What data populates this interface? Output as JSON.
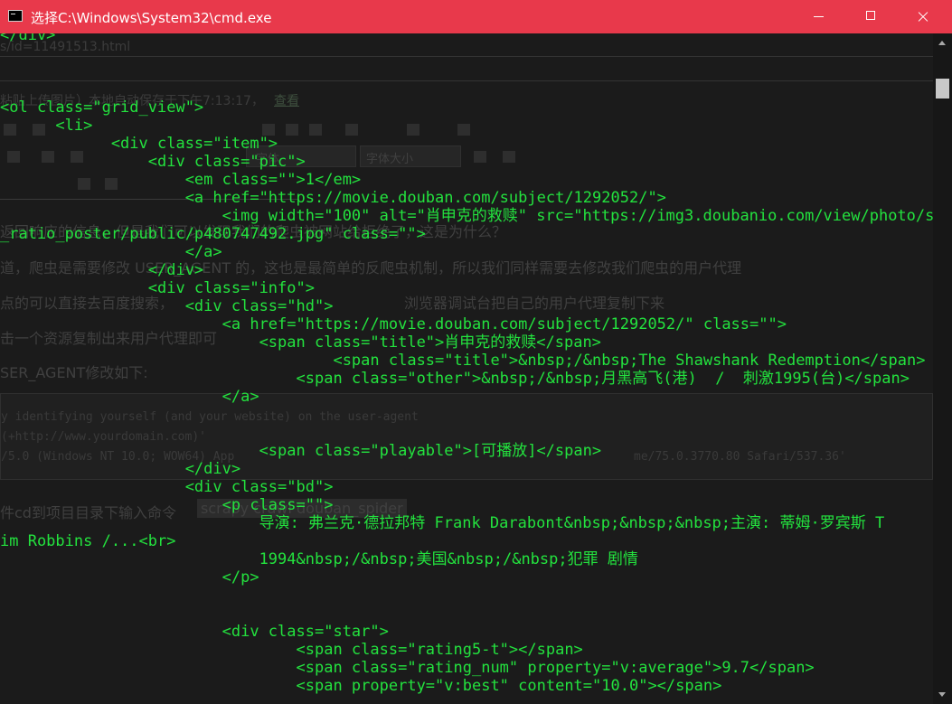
{
  "window": {
    "title": "选择C:\\Windows\\System32\\cmd.exe"
  },
  "background_page": {
    "url_fragment": "s/id=11491513.html",
    "autosave": "粘贴上传图片）本地自动保存于下午7:13:17，",
    "autosave_link": "查看",
    "font_select": "字体",
    "font_size_select": "字体大小",
    "paragraphs": [
      "返回响应的信息，但是我们可以发现我们的爬虫被网站给拒绝了，这是为什么？",
      "道，爬虫是需要修改 USER_AGENT 的，这也是最简单的反爬虫机制，所以我们同样需要去修改我们爬虫的用户代理",
      "点的可以直接去百度搜索，",
      "浏览器调试台把自己的用户代理复制下来",
      "击一个资源复制出来用户代理即可",
      "SER_AGENT修改如下:"
    ],
    "code_lines": [
      "y identifying yourself (and your website) on the user-agent",
      "  (+http://www.yourdomain.com)'",
      "/5.0 (Windows NT 10.0; WOW64) App",
      "me/75.0.3770.80 Safari/537.36'"
    ],
    "command_hint": "件cd到项目目录下输入命令",
    "command": "scrapy crawl douban_spider"
  },
  "console_lines": [
    "</div>",
    "",
    "",
    "",
    "<ol class=\"grid_view\">",
    "      <li>",
    "            <div class=\"item\">",
    "                <div class=\"pic\">",
    "                    <em class=\"\">1</em>",
    "                    <a href=\"https://movie.douban.com/subject/1292052/\">",
    "                        <img width=\"100\" alt=\"肖申克的救赎\" src=\"https://img3.doubanio.com/view/photo/s",
    "_ratio_poster/public/p480747492.jpg\" class=\"\">",
    "                    </a>",
    "                </div>",
    "                <div class=\"info\">",
    "                    <div class=\"hd\">",
    "                        <a href=\"https://movie.douban.com/subject/1292052/\" class=\"\">",
    "                            <span class=\"title\">肖申克的救赎</span>",
    "                                    <span class=\"title\">&nbsp;/&nbsp;The Shawshank Redemption</span>",
    "                                <span class=\"other\">&nbsp;/&nbsp;月黑高飞(港)  /  刺激1995(台)</span>",
    "                        </a>",
    "",
    "",
    "                            <span class=\"playable\">[可播放]</span>",
    "                    </div>",
    "                    <div class=\"bd\">",
    "                        <p class=\"\">",
    "                            导演: 弗兰克·德拉邦特 Frank Darabont&nbsp;&nbsp;&nbsp;主演: 蒂姆·罗宾斯 T",
    "im Robbins /...<br>",
    "                            1994&nbsp;/&nbsp;美国&nbsp;/&nbsp;犯罪 剧情",
    "                        </p>",
    "",
    "",
    "                        <div class=\"star\">",
    "                                <span class=\"rating5-t\"></span>",
    "                                <span class=\"rating_num\" property=\"v:average\">9.7</span>",
    "                                <span property=\"v:best\" content=\"10.0\"></span>"
  ]
}
